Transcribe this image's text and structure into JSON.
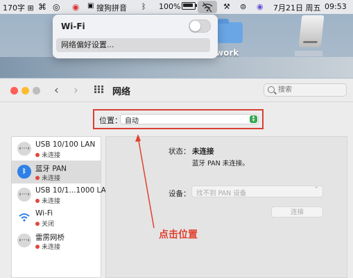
{
  "menubar": {
    "left_status": "170字 ⊞",
    "input_method": "搜狗拼音",
    "battery": "100%",
    "date": "7月21日 周五",
    "time": "09:53"
  },
  "wifi_menu": {
    "title": "Wi-Fi",
    "enabled": false,
    "preferences_label": "网络偏好设置..."
  },
  "desktop": {
    "folder_label": "work"
  },
  "window": {
    "title": "网络",
    "search_placeholder": "搜索"
  },
  "location": {
    "label": "位置：",
    "value": "自动"
  },
  "services": [
    {
      "name": "USB 10/100 LAN",
      "status": "未连接",
      "icon": "ethernet-icon",
      "icon_text": "‹···›",
      "selected": false
    },
    {
      "name": "蓝牙 PAN",
      "status": "未连接",
      "icon": "bluetooth-icon",
      "icon_text": "ᛒ",
      "selected": true
    },
    {
      "name": "USB 10/1...1000 LAN",
      "status": "未连接",
      "icon": "ethernet-icon",
      "icon_text": "‹···›",
      "selected": false
    },
    {
      "name": "Wi-Fi",
      "status": "关闭",
      "icon": "wifi-icon",
      "icon_text": "",
      "selected": false
    },
    {
      "name": "雷雳网桥",
      "status": "未连接",
      "icon": "thunderbolt-bridge-icon",
      "icon_text": "‹···›",
      "selected": false
    }
  ],
  "detail": {
    "status_label": "状态：",
    "status_value": "未连接",
    "status_desc": "蓝牙 PAN 未连接。",
    "device_label": "设备：",
    "device_placeholder": "找不到 PAN 设备",
    "connect_label": "连接"
  },
  "annotation": {
    "text": "点击位置",
    "color": "#e0402f"
  },
  "colors": {
    "status_red": "#e0483e",
    "highlight_red": "#d94034",
    "bluetooth_blue": "#2f80e7"
  }
}
